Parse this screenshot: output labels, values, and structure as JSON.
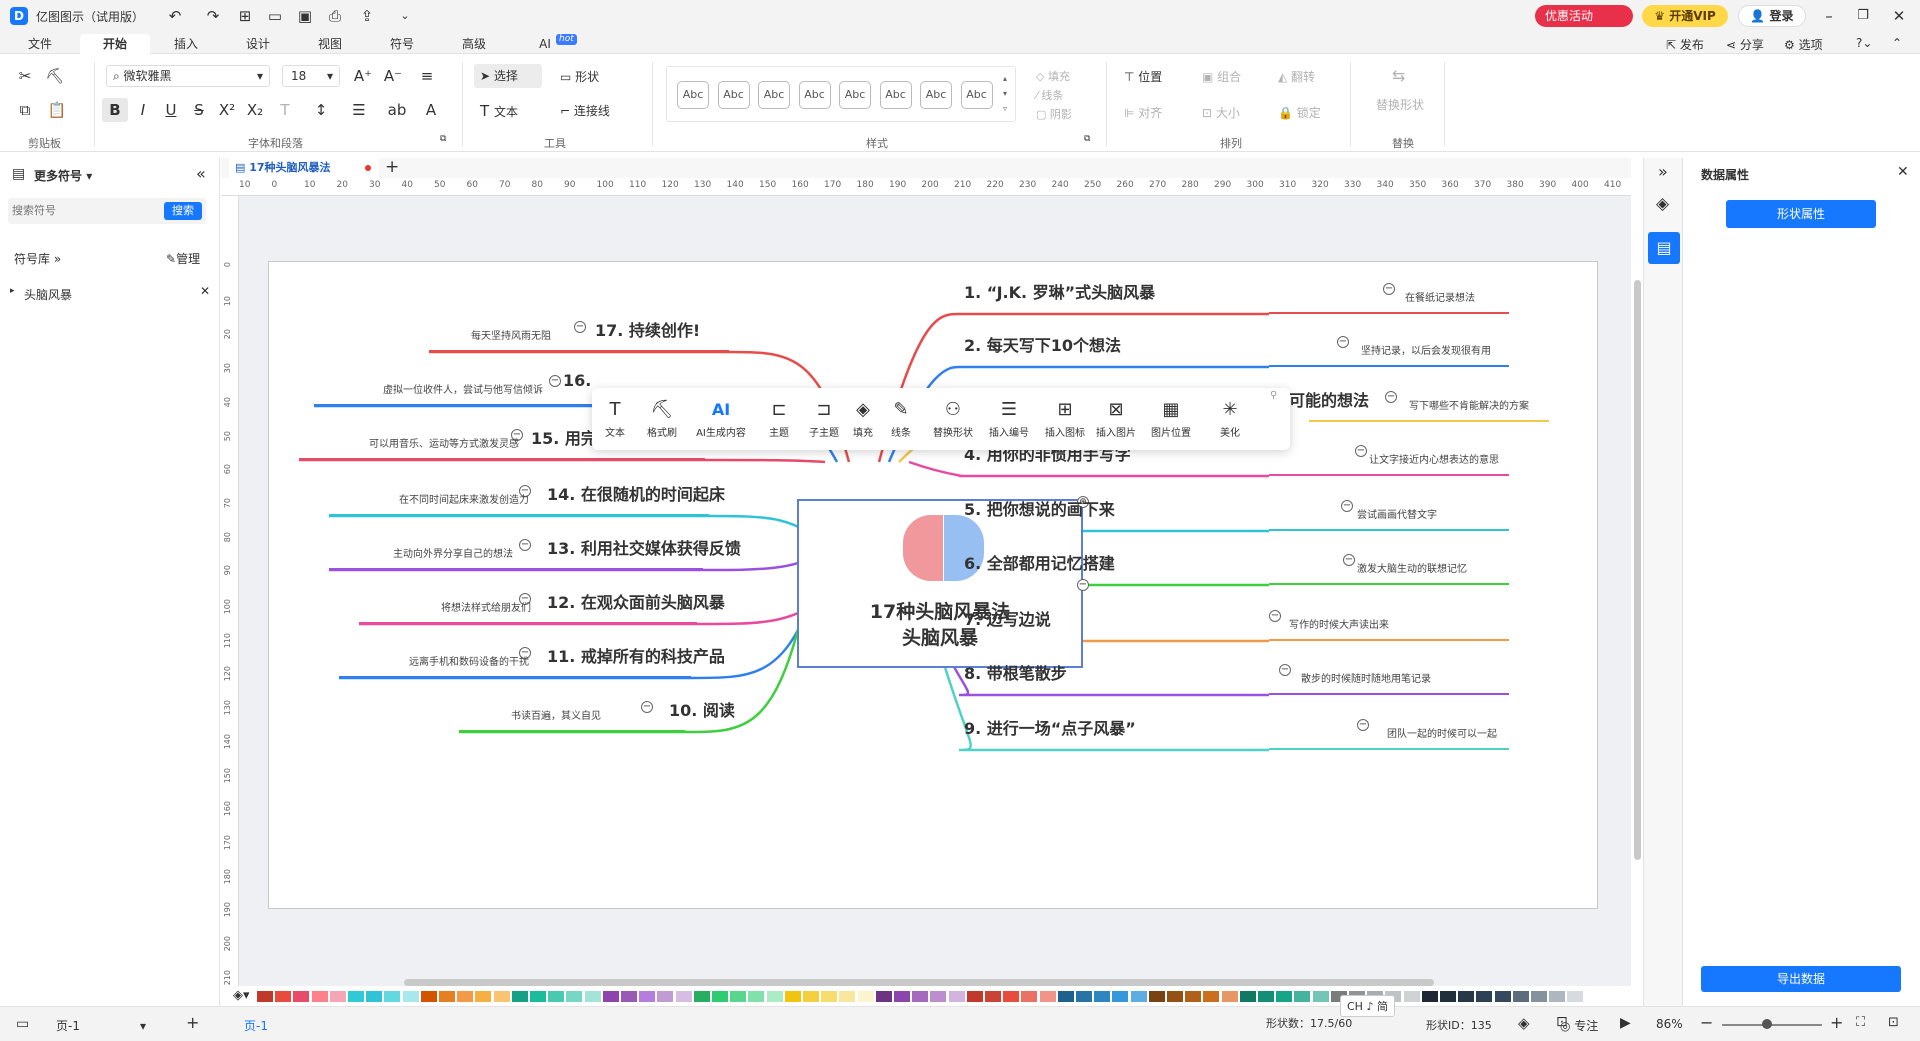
{
  "app": {
    "title": "亿图图示（试用版）",
    "promo_label": "优惠活动",
    "vip_label": "开通VIP",
    "login_label": "登录"
  },
  "menu_tabs": [
    {
      "label": "文件"
    },
    {
      "label": "开始"
    },
    {
      "label": "插入"
    },
    {
      "label": "设计"
    },
    {
      "label": "视图"
    },
    {
      "label": "符号"
    },
    {
      "label": "高级"
    },
    {
      "label": "AI"
    }
  ],
  "ai_badge": "hot",
  "top_actions": {
    "publish": "发布",
    "share": "分享",
    "options": "选项"
  },
  "ribbon": {
    "font_name": "微软雅黑",
    "font_size": "18",
    "select_label": "选择",
    "shape_label": "形状",
    "text_label": "文本",
    "connector_label": "连接线",
    "style_sample": "Abc",
    "fill_label": "填充",
    "line_label": "线条",
    "shadow_label": "阴影",
    "position_label": "位置",
    "align_label": "对齐",
    "group_label": "组合",
    "size_label": "大小",
    "flip_label": "翻转",
    "lock_label": "锁定",
    "replace_shape_label": "替换形状",
    "groups": {
      "clipboard": "剪贴板",
      "font_para": "字体和段落",
      "tools": "工具",
      "styles": "样式",
      "arrange": "排列",
      "replace": "替换"
    }
  },
  "left_panel": {
    "title": "更多符号",
    "search_placeholder": "搜索符号",
    "search_button": "搜索",
    "library_label": "符号库",
    "manage_label": "管理",
    "library_item": "头脑风暴"
  },
  "document": {
    "tab_title": "17种头脑风暴法",
    "ruler_ticks": [
      "10",
      "0",
      "10",
      "20",
      "30",
      "40",
      "50",
      "60",
      "70",
      "80",
      "90",
      "100",
      "110",
      "120",
      "130",
      "140",
      "150",
      "160",
      "170",
      "180",
      "190",
      "200",
      "210",
      "220",
      "230",
      "240",
      "250",
      "260",
      "270",
      "280",
      "290",
      "300",
      "310",
      "320",
      "330",
      "340",
      "350",
      "360",
      "370",
      "380",
      "390",
      "400",
      "410"
    ],
    "vruler_ticks": [
      "0",
      "10",
      "20",
      "30",
      "40",
      "50",
      "60",
      "70",
      "80",
      "90",
      "100",
      "110",
      "120",
      "130",
      "140",
      "150",
      "160",
      "170",
      "180",
      "190",
      "200",
      "210"
    ]
  },
  "mindmap": {
    "center_line1": "17种头脑风暴法",
    "center_line2": "头脑风暴",
    "right_topics": [
      {
        "label": "1. “J.K. 罗琳”式头脑风暴",
        "note": "在餐纸记录想法",
        "color": "#e74c4c"
      },
      {
        "label": "2. 每天写下10个想法",
        "note": "坚持记录，以后会发现很有用",
        "color": "#2f80ed"
      },
      {
        "label": "可能的想法",
        "note": "写下哪些不肯能解决的方案",
        "color": "#f2c94c"
      },
      {
        "label": "4. 用你的非惯用手写字",
        "note": "让文字接近内心想表达的意思",
        "color": "#e84aa0"
      },
      {
        "label": "5. 把你想说的画下来",
        "note": "尝试画画代替文字",
        "color": "#2ec4d6"
      },
      {
        "label": "6. 全部都用记忆搭建",
        "note": "激发大脑生动的联想记忆",
        "color": "#3ecf3e"
      },
      {
        "label": "7. 边写边说",
        "note": "写作的时候大声读出来",
        "color": "#f2994a"
      },
      {
        "label": "8. 带根笔散步",
        "note": "散步的时候随时随地用笔记录",
        "color": "#9b51e0"
      },
      {
        "label": "9. 进行一场“点子风暴”",
        "note": "团队一起的时候可以一起",
        "color": "#4fd1c5"
      }
    ],
    "left_topics": [
      {
        "label": "17. 持续创作!",
        "note": "每天坚持风雨无阻",
        "color": "#e74c4c"
      },
      {
        "label": "16.",
        "note": "虚拟一位收件人，尝试与他写信倾诉",
        "color": "#2f80ed"
      },
      {
        "label": "15. 用完全不同的方式创造",
        "note": "可以用音乐、运动等方式激发灵感",
        "color": "#e84a6a"
      },
      {
        "label": "14. 在很随机的时间起床",
        "note": "在不同时间起床来激发创造力",
        "color": "#2ec4d6"
      },
      {
        "label": "13. 利用社交媒体获得反馈",
        "note": "主动向外界分享自己的想法",
        "color": "#9b51e0"
      },
      {
        "label": "12. 在观众面前头脑风暴",
        "note": "将想法样式给朋友们",
        "color": "#e84aa0"
      },
      {
        "label": "11. 戒掉所有的科技产品",
        "note": "远离手机和数码设备的干扰",
        "color": "#2f80ed"
      },
      {
        "label": "10. 阅读",
        "note": "书读百遍，其义自见",
        "color": "#3ecf3e"
      }
    ]
  },
  "floating_toolbar": [
    {
      "label": "文本",
      "icon": "text-icon"
    },
    {
      "label": "格式刷",
      "icon": "format-brush-icon"
    },
    {
      "label": "AI生成内容",
      "icon": "ai-icon"
    },
    {
      "label": "主题",
      "icon": "topic-icon"
    },
    {
      "label": "子主题",
      "icon": "subtopic-icon"
    },
    {
      "label": "填充",
      "icon": "fill-icon"
    },
    {
      "label": "线条",
      "icon": "line-icon"
    },
    {
      "label": "替换形状",
      "icon": "replace-shape-icon"
    },
    {
      "label": "插入编号",
      "icon": "number-list-icon"
    },
    {
      "label": "插入图标",
      "icon": "insert-icon-icon"
    },
    {
      "label": "插入图片",
      "icon": "insert-image-icon"
    },
    {
      "label": "图片位置",
      "icon": "image-position-icon"
    },
    {
      "label": "美化",
      "icon": "beautify-icon"
    }
  ],
  "right_panel": {
    "title": "数据属性",
    "shape_props_button": "形状属性",
    "export_button": "导出数据"
  },
  "status": {
    "page_name": "页-1",
    "page_tab": "页-1",
    "shape_count": "形状数：17.5/60",
    "shape_id": "形状ID：135",
    "focus_label": "专注",
    "zoom": "86%",
    "ime": "CH ♪ 简"
  },
  "colors": {
    "accent": "#1677ff",
    "palette": [
      "#c0392b",
      "#e74c3c",
      "#e84a6a",
      "#ff7f8a",
      "#f4a6b4",
      "#2ecbd6",
      "#2ec4d6",
      "#62d9e0",
      "#a7e8ef",
      "#d35400",
      "#e67e22",
      "#f2994a",
      "#f5b041",
      "#f8c471",
      "#16a085",
      "#1abc9c",
      "#48c9b0",
      "#76d7c4",
      "#a3e4d7",
      "#8e44ad",
      "#9b59b6",
      "#b57edc",
      "#c39bd3",
      "#d7bde2",
      "#27ae60",
      "#2ecc71",
      "#58d68d",
      "#82e0aa",
      "#abebc6",
      "#f1c40f",
      "#f4d03f",
      "#f7dc6f",
      "#f9e79f",
      "#fcf3cf",
      "#6c3483",
      "#8e44ad",
      "#a569bd",
      "#bb8fce",
      "#d2b4de",
      "#c0392b",
      "#cb4335",
      "#e74c3c",
      "#ec7063",
      "#f1948a",
      "#1f618d",
      "#2874a6",
      "#2e86c1",
      "#3498db",
      "#5dade2",
      "#784212",
      "#935116",
      "#af601a",
      "#ca6f1e",
      "#e59866",
      "#117864",
      "#148f77",
      "#17a589",
      "#45b39d",
      "#73c6b6",
      "#7b7d7d",
      "#909497",
      "#a6acaf",
      "#bdc3c7",
      "#d0d3d4",
      "#1c2833",
      "#212f3d",
      "#283747",
      "#2e4053",
      "#34495e",
      "#5d6d7e",
      "#85929e",
      "#aeb6bf",
      "#d6dbdf"
    ]
  }
}
